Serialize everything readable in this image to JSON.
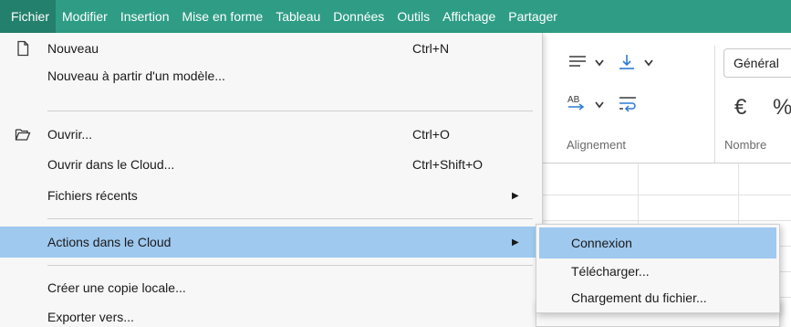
{
  "menubar": {
    "items": [
      {
        "label": "Fichier"
      },
      {
        "label": "Modifier"
      },
      {
        "label": "Insertion"
      },
      {
        "label": "Mise en forme"
      },
      {
        "label": "Tableau"
      },
      {
        "label": "Données"
      },
      {
        "label": "Outils"
      },
      {
        "label": "Affichage"
      },
      {
        "label": "Partager"
      }
    ]
  },
  "ribbon": {
    "number_format": "Général",
    "groups": {
      "alignment": "Alignement",
      "number": "Nombre"
    },
    "currency_symbol": "€",
    "percent_symbol": "%"
  },
  "file_menu": {
    "items": [
      {
        "label": "Nouveau",
        "shortcut": "Ctrl+N",
        "icon": "new-file-icon"
      },
      {
        "label": "Nouveau à partir d'un modèle...",
        "shortcut": ""
      },
      {
        "label": "Ouvrir...",
        "shortcut": "Ctrl+O",
        "icon": "open-folder-icon"
      },
      {
        "label": "Ouvrir dans le Cloud...",
        "shortcut": "Ctrl+Shift+O"
      },
      {
        "label": "Fichiers récents",
        "shortcut": "",
        "submenu": true
      },
      {
        "label": "Actions dans le Cloud",
        "shortcut": "",
        "submenu": true,
        "highlighted": true
      },
      {
        "label": "Créer une copie locale...",
        "shortcut": ""
      },
      {
        "label": "Exporter vers...",
        "shortcut": ""
      }
    ]
  },
  "cloud_submenu": {
    "items": [
      {
        "label": "Connexion",
        "highlighted": true
      },
      {
        "label": "Télécharger..."
      },
      {
        "label": "Chargement du fichier..."
      }
    ]
  },
  "colors": {
    "menubar_bg": "#2f9d86",
    "highlight": "#9fc9ef",
    "menu_bg": "#f7f7f7"
  }
}
